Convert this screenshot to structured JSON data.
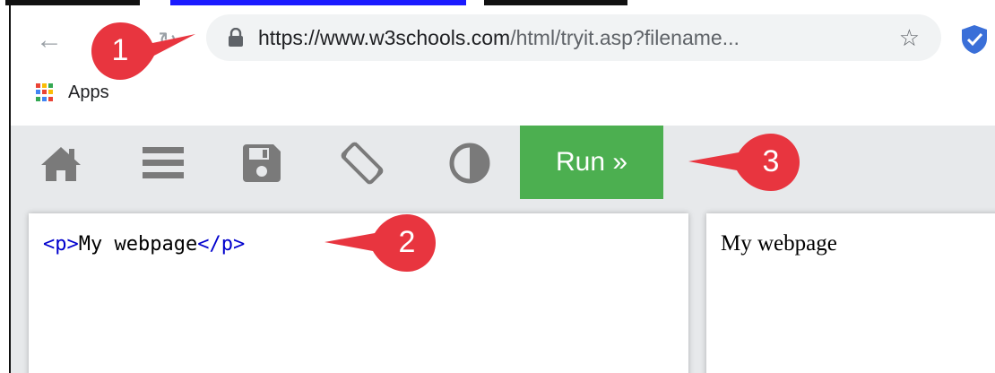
{
  "browser": {
    "url_main": "https://www.w3schools.com",
    "url_rest": "/html/tryit.asp?filename...",
    "bookmarks_label": "Apps",
    "icons": [
      "back-arrow-icon",
      "reload-icon",
      "lock-icon",
      "star-icon",
      "shield-extension-icon",
      "apps-grid-icon"
    ]
  },
  "toolbar": {
    "run_label": "Run »",
    "icons": [
      "home-icon",
      "menu-icon",
      "save-icon",
      "rotate-icon",
      "contrast-icon"
    ],
    "run_color": "#4CAF50"
  },
  "editor": {
    "open_tag": "<p>",
    "text": "My webpage",
    "close_tag": "</p>"
  },
  "result": {
    "text": "My webpage"
  },
  "callouts": [
    "1",
    "2",
    "3"
  ],
  "colors": {
    "callout_red": "#E8353F",
    "toolbar_bg": "#E7E9EB"
  }
}
